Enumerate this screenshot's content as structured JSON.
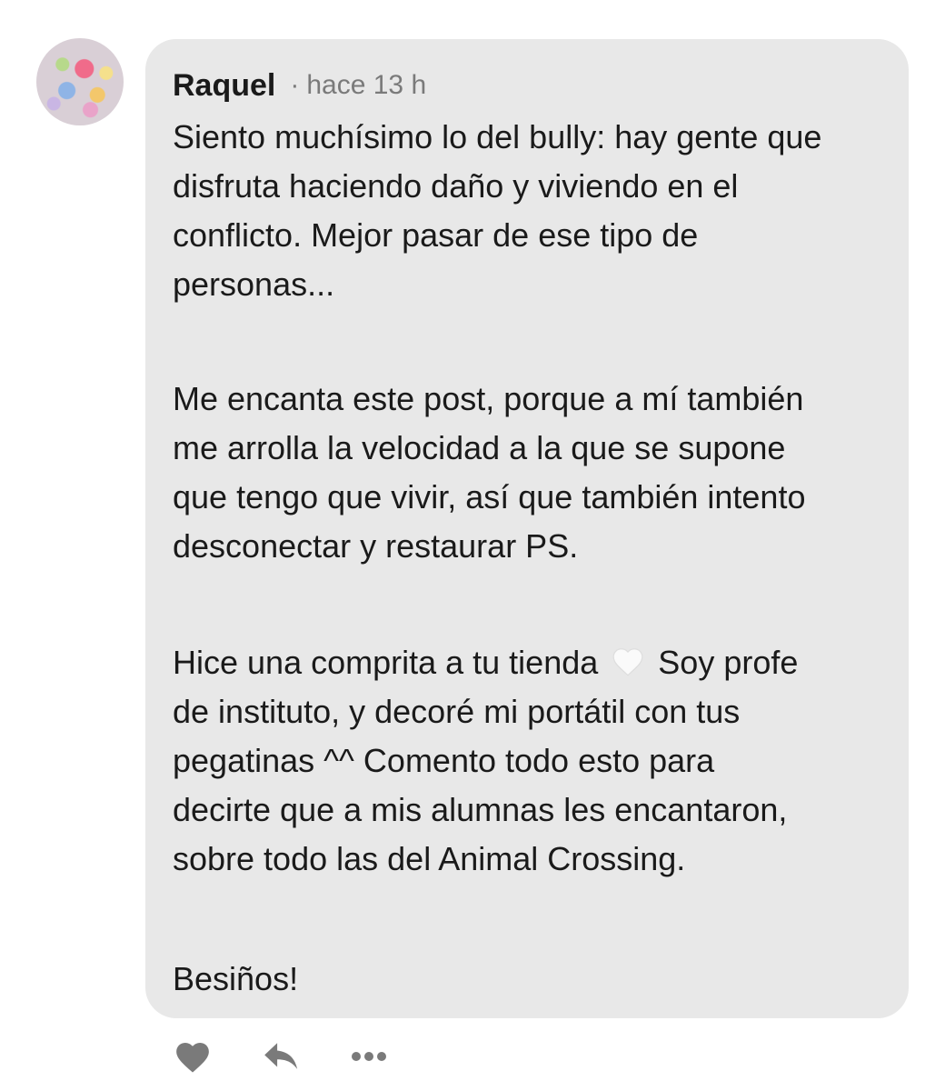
{
  "comment": {
    "author": "Raquel",
    "separator": "·",
    "time": "hace 13 h",
    "paragraph_1": "Siento muchísimo lo del bully: hay gente que\ndisfruta haciendo daño y viviendo en el\nconflicto. Mejor pasar de ese tipo de\npersonas...",
    "paragraph_2": "Me encanta este post, porque a mí también\nme arrolla la velocidad a la que se supone\nque tengo que vivir, así que también intento\ndesconectar y restaurar PS.",
    "paragraph_3_before_emoji": "Hice una comprita a tu tienda",
    "paragraph_3_emoji": "white-heart-emoji",
    "paragraph_3_after_emoji": "Soy profe\nde instituto, y decoré mi portátil con tus\npegatinas ^^ Comento todo esto para\ndecirte que a mis alumnas les encantaron,\nsobre todo las del Animal Crossing.",
    "paragraph_4": "Besiños!"
  },
  "actions": {
    "like_icon": "heart-icon",
    "reply_icon": "reply-arrow-icon",
    "more_icon": "more-dots-icon",
    "icon_color": "#7a7a7a"
  },
  "colors": {
    "bubble_background": "#e8e8e8",
    "text": "#1a1a1a",
    "muted_text": "#7a7a7a"
  }
}
